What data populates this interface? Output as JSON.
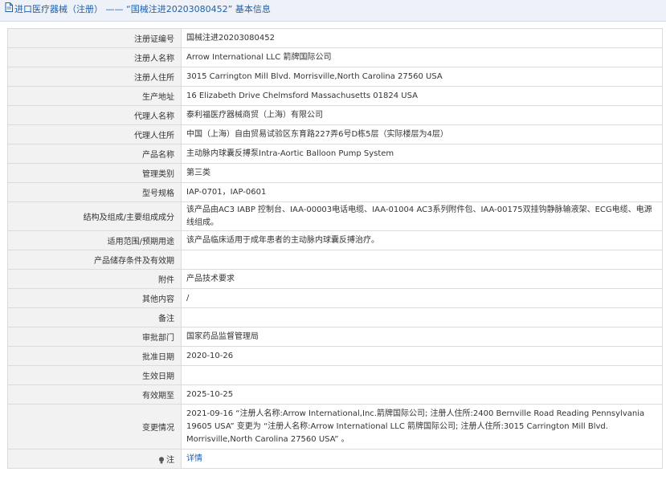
{
  "header": {
    "title": "进口医疗器械（注册） —— “国械注进20203080452” 基本信息"
  },
  "rows": [
    {
      "label": "注册证编号",
      "value": "国械注进20203080452"
    },
    {
      "label": "注册人名称",
      "value": "Arrow International LLC 箭牌国际公司"
    },
    {
      "label": "注册人住所",
      "value": "3015 Carrington Mill Blvd. Morrisville,North Carolina 27560 USA"
    },
    {
      "label": "生产地址",
      "value": "16 Elizabeth Drive Chelmsford Massachusetts 01824 USA"
    },
    {
      "label": "代理人名称",
      "value": "泰利福医疗器械商贸（上海）有限公司"
    },
    {
      "label": "代理人住所",
      "value": "中国（上海）自由贸易试验区东育路227弄6号D栋5层（实际楼层为4层）"
    },
    {
      "label": "产品名称",
      "value": "主动脉内球囊反搏泵Intra-Aortic Balloon Pump System"
    },
    {
      "label": "管理类别",
      "value": "第三类"
    },
    {
      "label": "型号规格",
      "value": "IAP-0701，IAP-0601"
    },
    {
      "label": "结构及组成/主要组成成分",
      "value": "该产品由AC3 IABP 控制台、IAA-00003电话电缆、IAA-01004 AC3系列附件包、IAA-00175双挂钩静脉输液架、ECG电缆、电源线组成。"
    },
    {
      "label": "适用范围/预期用途",
      "value": "该产品临床适用于成年患者的主动脉内球囊反搏治疗。"
    },
    {
      "label": "产品储存条件及有效期",
      "value": ""
    },
    {
      "label": "附件",
      "value": "产品技术要求"
    },
    {
      "label": "其他内容",
      "value": "/"
    },
    {
      "label": "备注",
      "value": ""
    },
    {
      "label": "审批部门",
      "value": "国家药品监督管理局"
    },
    {
      "label": "批准日期",
      "value": "2020-10-26"
    },
    {
      "label": "生效日期",
      "value": ""
    },
    {
      "label": "有效期至",
      "value": "2025-10-25"
    },
    {
      "label": "变更情况",
      "value": "2021-09-16 “注册人名称:Arrow International,Inc.箭牌国际公司; 注册人住所:2400 Bernville Road Reading Pennsylvania 19605 USA” 变更为 “注册人名称:Arrow International LLC 箭牌国际公司; 注册人住所:3015 Carrington Mill Blvd. Morrisville,North Carolina 27560 USA” 。"
    }
  ],
  "footer_row": {
    "label": "注",
    "link": "详情",
    "icon": "lightbulb-icon"
  }
}
